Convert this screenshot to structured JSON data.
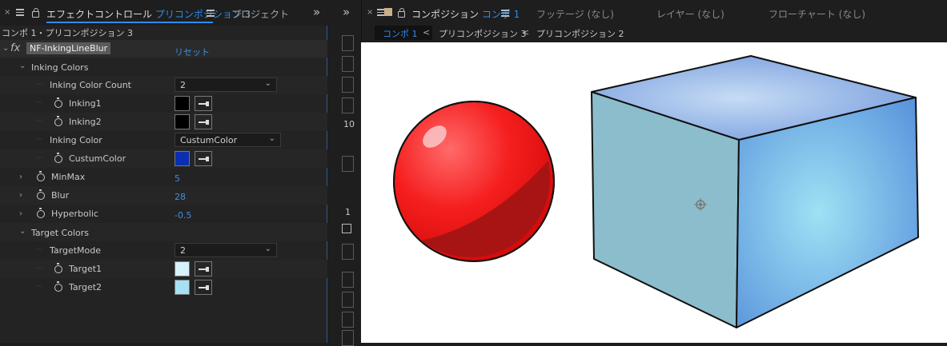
{
  "effect_panel": {
    "tab_close": "×",
    "tab_title": "エフェクトコントロール",
    "tab_subject": "プリコンポジション 3",
    "tab_project": "プロジェクト",
    "overflow": "»",
    "breadcrumb": "コンポ 1・プリコンポジション 3",
    "effect": {
      "fx_label": "fx",
      "name": "NF-InkingLineBlur",
      "reset": "リセット"
    },
    "params": {
      "inking_colors_group": "Inking Colors",
      "inking_color_count": {
        "label": "Inking Color Count",
        "value": "2"
      },
      "inking1": {
        "label": "Inking1",
        "color": "#000000"
      },
      "inking2": {
        "label": "Inking2",
        "color": "#000000"
      },
      "inking_color": {
        "label": "Inking Color",
        "value": "CustumColor"
      },
      "custum_color": {
        "label": "CustumColor",
        "color": "#0a2fb0"
      },
      "minmax": {
        "label": "MinMax",
        "value": "5"
      },
      "blur": {
        "label": "Blur",
        "value": "28"
      },
      "hyperbolic": {
        "label": "Hyperbolic",
        "value": "-0.5"
      },
      "target_colors_group": "Target Colors",
      "target_mode": {
        "label": "TargetMode",
        "value": "2"
      },
      "target1": {
        "label": "Target1",
        "color": "#d8f2fa"
      },
      "target2": {
        "label": "Target2",
        "color": "#a8e0f3"
      }
    }
  },
  "mid_strip": {
    "overflow": "»",
    "value_10": "10",
    "value_1": "1"
  },
  "comp_panel": {
    "tab_close": "×",
    "tab_title": "コンポジション",
    "tab_subject": "コンポ 1",
    "footage_tab": "フッテージ (なし)",
    "layer_tab": "レイヤー (なし)",
    "flowchart_tab": "フローチャート (なし)",
    "breadcrumbs": [
      "コンポ 1",
      "プリコンポジション 3",
      "プリコンポジション 2"
    ],
    "sep": "<"
  },
  "colors": {
    "accent": "#2d8ceb",
    "value_blue": "#3c8fe0"
  }
}
